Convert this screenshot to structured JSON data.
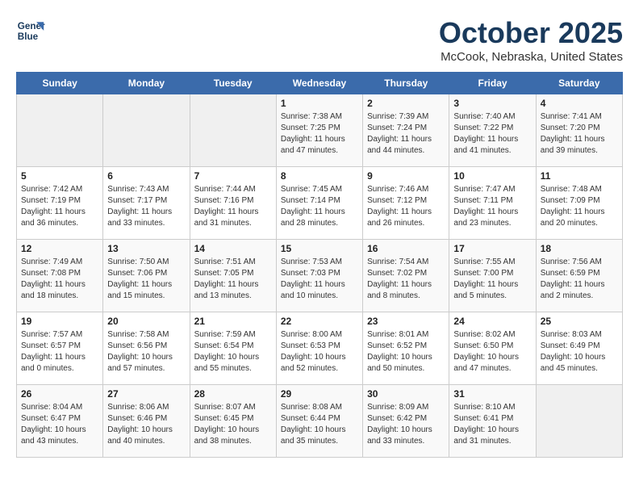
{
  "header": {
    "logo_line1": "General",
    "logo_line2": "Blue",
    "title": "October 2025",
    "subtitle": "McCook, Nebraska, United States"
  },
  "weekdays": [
    "Sunday",
    "Monday",
    "Tuesday",
    "Wednesday",
    "Thursday",
    "Friday",
    "Saturday"
  ],
  "weeks": [
    [
      {
        "day": "",
        "content": ""
      },
      {
        "day": "",
        "content": ""
      },
      {
        "day": "",
        "content": ""
      },
      {
        "day": "1",
        "content": "Sunrise: 7:38 AM\nSunset: 7:25 PM\nDaylight: 11 hours and 47 minutes."
      },
      {
        "day": "2",
        "content": "Sunrise: 7:39 AM\nSunset: 7:24 PM\nDaylight: 11 hours and 44 minutes."
      },
      {
        "day": "3",
        "content": "Sunrise: 7:40 AM\nSunset: 7:22 PM\nDaylight: 11 hours and 41 minutes."
      },
      {
        "day": "4",
        "content": "Sunrise: 7:41 AM\nSunset: 7:20 PM\nDaylight: 11 hours and 39 minutes."
      }
    ],
    [
      {
        "day": "5",
        "content": "Sunrise: 7:42 AM\nSunset: 7:19 PM\nDaylight: 11 hours and 36 minutes."
      },
      {
        "day": "6",
        "content": "Sunrise: 7:43 AM\nSunset: 7:17 PM\nDaylight: 11 hours and 33 minutes."
      },
      {
        "day": "7",
        "content": "Sunrise: 7:44 AM\nSunset: 7:16 PM\nDaylight: 11 hours and 31 minutes."
      },
      {
        "day": "8",
        "content": "Sunrise: 7:45 AM\nSunset: 7:14 PM\nDaylight: 11 hours and 28 minutes."
      },
      {
        "day": "9",
        "content": "Sunrise: 7:46 AM\nSunset: 7:12 PM\nDaylight: 11 hours and 26 minutes."
      },
      {
        "day": "10",
        "content": "Sunrise: 7:47 AM\nSunset: 7:11 PM\nDaylight: 11 hours and 23 minutes."
      },
      {
        "day": "11",
        "content": "Sunrise: 7:48 AM\nSunset: 7:09 PM\nDaylight: 11 hours and 20 minutes."
      }
    ],
    [
      {
        "day": "12",
        "content": "Sunrise: 7:49 AM\nSunset: 7:08 PM\nDaylight: 11 hours and 18 minutes."
      },
      {
        "day": "13",
        "content": "Sunrise: 7:50 AM\nSunset: 7:06 PM\nDaylight: 11 hours and 15 minutes."
      },
      {
        "day": "14",
        "content": "Sunrise: 7:51 AM\nSunset: 7:05 PM\nDaylight: 11 hours and 13 minutes."
      },
      {
        "day": "15",
        "content": "Sunrise: 7:53 AM\nSunset: 7:03 PM\nDaylight: 11 hours and 10 minutes."
      },
      {
        "day": "16",
        "content": "Sunrise: 7:54 AM\nSunset: 7:02 PM\nDaylight: 11 hours and 8 minutes."
      },
      {
        "day": "17",
        "content": "Sunrise: 7:55 AM\nSunset: 7:00 PM\nDaylight: 11 hours and 5 minutes."
      },
      {
        "day": "18",
        "content": "Sunrise: 7:56 AM\nSunset: 6:59 PM\nDaylight: 11 hours and 2 minutes."
      }
    ],
    [
      {
        "day": "19",
        "content": "Sunrise: 7:57 AM\nSunset: 6:57 PM\nDaylight: 11 hours and 0 minutes."
      },
      {
        "day": "20",
        "content": "Sunrise: 7:58 AM\nSunset: 6:56 PM\nDaylight: 10 hours and 57 minutes."
      },
      {
        "day": "21",
        "content": "Sunrise: 7:59 AM\nSunset: 6:54 PM\nDaylight: 10 hours and 55 minutes."
      },
      {
        "day": "22",
        "content": "Sunrise: 8:00 AM\nSunset: 6:53 PM\nDaylight: 10 hours and 52 minutes."
      },
      {
        "day": "23",
        "content": "Sunrise: 8:01 AM\nSunset: 6:52 PM\nDaylight: 10 hours and 50 minutes."
      },
      {
        "day": "24",
        "content": "Sunrise: 8:02 AM\nSunset: 6:50 PM\nDaylight: 10 hours and 47 minutes."
      },
      {
        "day": "25",
        "content": "Sunrise: 8:03 AM\nSunset: 6:49 PM\nDaylight: 10 hours and 45 minutes."
      }
    ],
    [
      {
        "day": "26",
        "content": "Sunrise: 8:04 AM\nSunset: 6:47 PM\nDaylight: 10 hours and 43 minutes."
      },
      {
        "day": "27",
        "content": "Sunrise: 8:06 AM\nSunset: 6:46 PM\nDaylight: 10 hours and 40 minutes."
      },
      {
        "day": "28",
        "content": "Sunrise: 8:07 AM\nSunset: 6:45 PM\nDaylight: 10 hours and 38 minutes."
      },
      {
        "day": "29",
        "content": "Sunrise: 8:08 AM\nSunset: 6:44 PM\nDaylight: 10 hours and 35 minutes."
      },
      {
        "day": "30",
        "content": "Sunrise: 8:09 AM\nSunset: 6:42 PM\nDaylight: 10 hours and 33 minutes."
      },
      {
        "day": "31",
        "content": "Sunrise: 8:10 AM\nSunset: 6:41 PM\nDaylight: 10 hours and 31 minutes."
      },
      {
        "day": "",
        "content": ""
      }
    ]
  ]
}
